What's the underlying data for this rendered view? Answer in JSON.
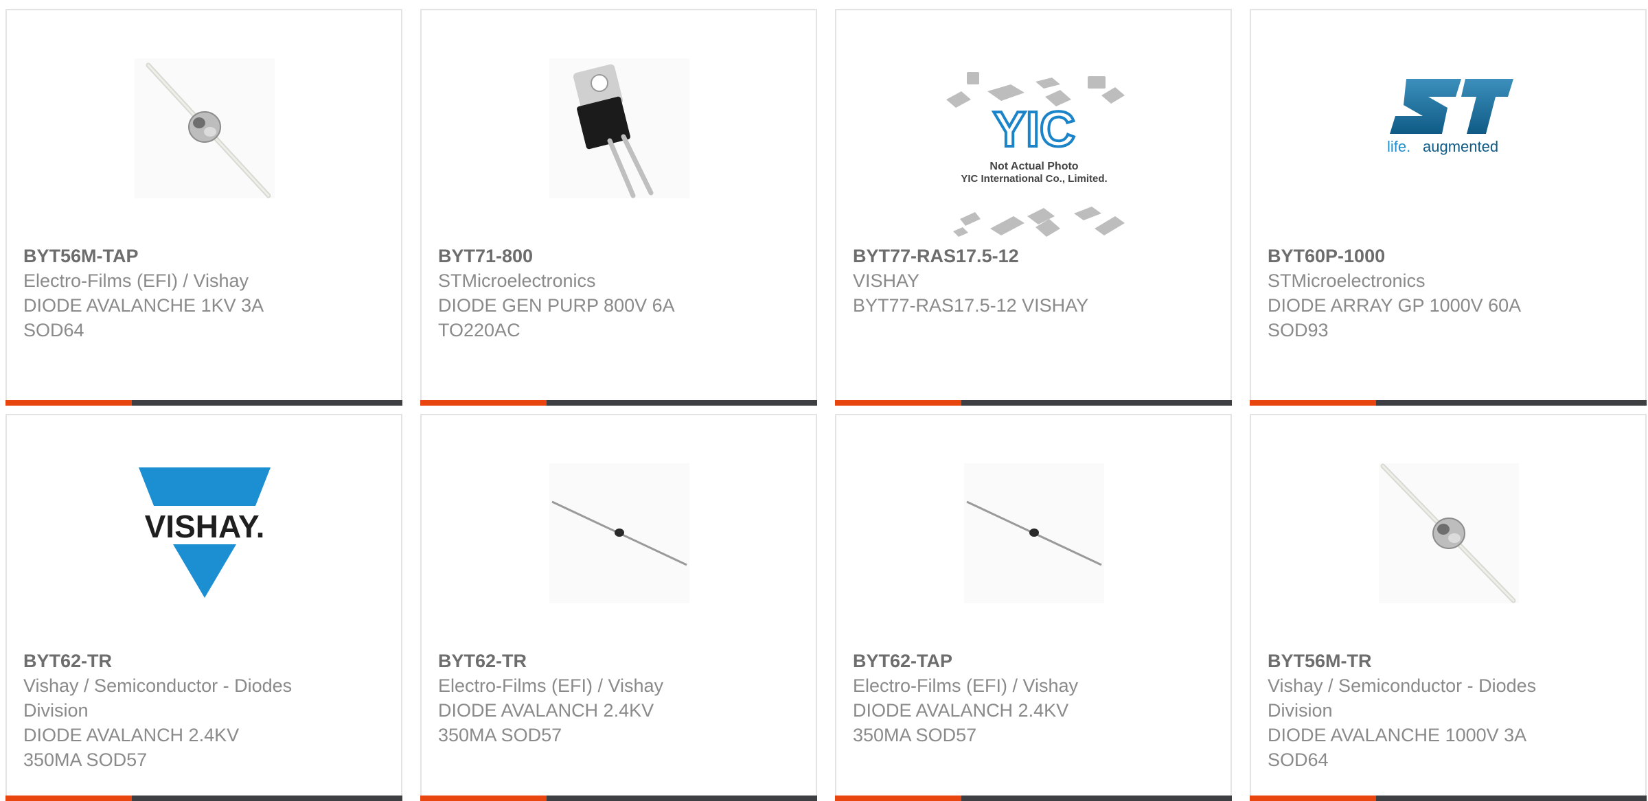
{
  "products": [
    {
      "part": "BYT56M-TAP",
      "maker": "Electro-Films (EFI) / Vishay",
      "desc_lines": [
        "DIODE AVALANCHE 1KV 3A",
        "SOD64"
      ],
      "image": "axial-diode-sod64-icon"
    },
    {
      "part": "BYT71-800",
      "maker": "STMicroelectronics",
      "desc_lines": [
        "DIODE GEN PURP 800V 6A",
        "TO220AC"
      ],
      "image": "to220-package-icon"
    },
    {
      "part": "BYT77-RAS17.5-12",
      "maker": "VISHAY",
      "desc_lines": [
        "BYT77-RAS17.5-12 VISHAY"
      ],
      "image": "yic-not-actual-photo-icon",
      "image_text": {
        "logo": "YIC",
        "note1": "Not Actual Photo",
        "note2": "YIC International Co., Limited."
      }
    },
    {
      "part": "BYT60P-1000",
      "maker": "STMicroelectronics",
      "desc_lines": [
        "DIODE ARRAY GP 1000V 60A",
        "SOD93"
      ],
      "image": "st-logo-icon",
      "image_text": {
        "tagline_a": "life.",
        "tagline_b": "augmented"
      }
    },
    {
      "part": "BYT62-TR",
      "maker_lines": [
        "Vishay / Semiconductor - Diodes",
        "Division"
      ],
      "desc_lines": [
        "DIODE AVALANCH 2.4KV",
        "350MA SOD57"
      ],
      "image": "vishay-logo-icon",
      "image_text": {
        "logo": "VISHAY."
      }
    },
    {
      "part": "BYT62-TR",
      "maker": "Electro-Films (EFI) / Vishay",
      "desc_lines": [
        "DIODE AVALANCH 2.4KV",
        "350MA SOD57"
      ],
      "image": "axial-diode-sod57-icon"
    },
    {
      "part": "BYT62-TAP",
      "maker": "Electro-Films (EFI) / Vishay",
      "desc_lines": [
        "DIODE AVALANCH 2.4KV",
        "350MA SOD57"
      ],
      "image": "axial-diode-sod57-icon"
    },
    {
      "part": "BYT56M-TR",
      "maker_lines": [
        "Vishay / Semiconductor - Diodes",
        "Division"
      ],
      "desc_lines": [
        "DIODE AVALANCHE 1000V 3A",
        "SOD64"
      ],
      "image": "axial-diode-sod64-icon"
    }
  ],
  "colors": {
    "accent_bar": "#e8450f",
    "bar": "#3d3f42",
    "card_border": "#e3e3e3",
    "part_text": "#6d6d6d",
    "body_text": "#8a8a8a",
    "st_blue": "#1f6f9a",
    "vishay_blue": "#1b8fd2"
  }
}
